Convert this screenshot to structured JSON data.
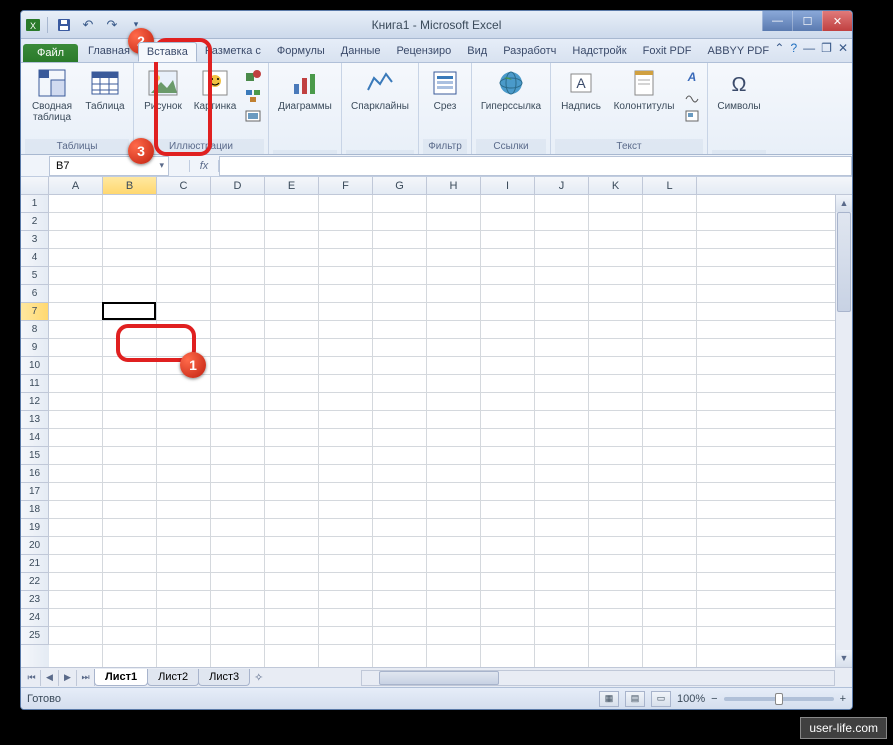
{
  "title": "Книга1 - Microsoft Excel",
  "file_tab": "Файл",
  "tabs": [
    "Главная",
    "Вставка",
    "Разметка с",
    "Формулы",
    "Данные",
    "Рецензиро",
    "Вид",
    "Разработч",
    "Надстройк",
    "Foxit PDF",
    "ABBYY PDF"
  ],
  "active_tab": 1,
  "ribbon": {
    "groups": [
      {
        "label": "Таблицы",
        "items": [
          "Сводная таблица",
          "Таблица"
        ]
      },
      {
        "label": "Иллюстрации",
        "items": [
          "Рисунок",
          "Картинка"
        ]
      },
      {
        "label": "",
        "items": [
          "Диаграммы"
        ]
      },
      {
        "label": "",
        "items": [
          "Спарклайны"
        ]
      },
      {
        "label": "Фильтр",
        "items": [
          "Срез"
        ]
      },
      {
        "label": "Ссылки",
        "items": [
          "Гиперссылка"
        ]
      },
      {
        "label": "Текст",
        "items": [
          "Надпись",
          "Колонтитулы"
        ]
      },
      {
        "label": "",
        "items": [
          "Символы"
        ]
      }
    ]
  },
  "name_box": "B7",
  "fx": "fx",
  "columns": [
    "A",
    "B",
    "C",
    "D",
    "E",
    "F",
    "G",
    "H",
    "I",
    "J",
    "K",
    "L"
  ],
  "row_count": 25,
  "selected": {
    "col_index": 1,
    "row": 7
  },
  "sheets": [
    "Лист1",
    "Лист2",
    "Лист3"
  ],
  "active_sheet": 0,
  "status": "Готово",
  "zoom": "100%",
  "watermark": "user-life.com",
  "badges": {
    "b1": "1",
    "b2": "2",
    "b3": "3"
  }
}
